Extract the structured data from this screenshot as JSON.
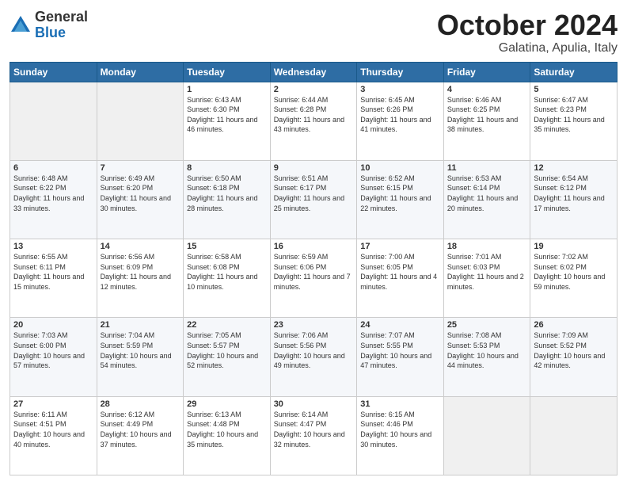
{
  "logo": {
    "general": "General",
    "blue": "Blue"
  },
  "title": {
    "month": "October 2024",
    "location": "Galatina, Apulia, Italy"
  },
  "headers": [
    "Sunday",
    "Monday",
    "Tuesday",
    "Wednesday",
    "Thursday",
    "Friday",
    "Saturday"
  ],
  "weeks": [
    [
      {
        "day": "",
        "info": ""
      },
      {
        "day": "",
        "info": ""
      },
      {
        "day": "1",
        "info": "Sunrise: 6:43 AM\nSunset: 6:30 PM\nDaylight: 11 hours and 46 minutes."
      },
      {
        "day": "2",
        "info": "Sunrise: 6:44 AM\nSunset: 6:28 PM\nDaylight: 11 hours and 43 minutes."
      },
      {
        "day": "3",
        "info": "Sunrise: 6:45 AM\nSunset: 6:26 PM\nDaylight: 11 hours and 41 minutes."
      },
      {
        "day": "4",
        "info": "Sunrise: 6:46 AM\nSunset: 6:25 PM\nDaylight: 11 hours and 38 minutes."
      },
      {
        "day": "5",
        "info": "Sunrise: 6:47 AM\nSunset: 6:23 PM\nDaylight: 11 hours and 35 minutes."
      }
    ],
    [
      {
        "day": "6",
        "info": "Sunrise: 6:48 AM\nSunset: 6:22 PM\nDaylight: 11 hours and 33 minutes."
      },
      {
        "day": "7",
        "info": "Sunrise: 6:49 AM\nSunset: 6:20 PM\nDaylight: 11 hours and 30 minutes."
      },
      {
        "day": "8",
        "info": "Sunrise: 6:50 AM\nSunset: 6:18 PM\nDaylight: 11 hours and 28 minutes."
      },
      {
        "day": "9",
        "info": "Sunrise: 6:51 AM\nSunset: 6:17 PM\nDaylight: 11 hours and 25 minutes."
      },
      {
        "day": "10",
        "info": "Sunrise: 6:52 AM\nSunset: 6:15 PM\nDaylight: 11 hours and 22 minutes."
      },
      {
        "day": "11",
        "info": "Sunrise: 6:53 AM\nSunset: 6:14 PM\nDaylight: 11 hours and 20 minutes."
      },
      {
        "day": "12",
        "info": "Sunrise: 6:54 AM\nSunset: 6:12 PM\nDaylight: 11 hours and 17 minutes."
      }
    ],
    [
      {
        "day": "13",
        "info": "Sunrise: 6:55 AM\nSunset: 6:11 PM\nDaylight: 11 hours and 15 minutes."
      },
      {
        "day": "14",
        "info": "Sunrise: 6:56 AM\nSunset: 6:09 PM\nDaylight: 11 hours and 12 minutes."
      },
      {
        "day": "15",
        "info": "Sunrise: 6:58 AM\nSunset: 6:08 PM\nDaylight: 11 hours and 10 minutes."
      },
      {
        "day": "16",
        "info": "Sunrise: 6:59 AM\nSunset: 6:06 PM\nDaylight: 11 hours and 7 minutes."
      },
      {
        "day": "17",
        "info": "Sunrise: 7:00 AM\nSunset: 6:05 PM\nDaylight: 11 hours and 4 minutes."
      },
      {
        "day": "18",
        "info": "Sunrise: 7:01 AM\nSunset: 6:03 PM\nDaylight: 11 hours and 2 minutes."
      },
      {
        "day": "19",
        "info": "Sunrise: 7:02 AM\nSunset: 6:02 PM\nDaylight: 10 hours and 59 minutes."
      }
    ],
    [
      {
        "day": "20",
        "info": "Sunrise: 7:03 AM\nSunset: 6:00 PM\nDaylight: 10 hours and 57 minutes."
      },
      {
        "day": "21",
        "info": "Sunrise: 7:04 AM\nSunset: 5:59 PM\nDaylight: 10 hours and 54 minutes."
      },
      {
        "day": "22",
        "info": "Sunrise: 7:05 AM\nSunset: 5:57 PM\nDaylight: 10 hours and 52 minutes."
      },
      {
        "day": "23",
        "info": "Sunrise: 7:06 AM\nSunset: 5:56 PM\nDaylight: 10 hours and 49 minutes."
      },
      {
        "day": "24",
        "info": "Sunrise: 7:07 AM\nSunset: 5:55 PM\nDaylight: 10 hours and 47 minutes."
      },
      {
        "day": "25",
        "info": "Sunrise: 7:08 AM\nSunset: 5:53 PM\nDaylight: 10 hours and 44 minutes."
      },
      {
        "day": "26",
        "info": "Sunrise: 7:09 AM\nSunset: 5:52 PM\nDaylight: 10 hours and 42 minutes."
      }
    ],
    [
      {
        "day": "27",
        "info": "Sunrise: 6:11 AM\nSunset: 4:51 PM\nDaylight: 10 hours and 40 minutes."
      },
      {
        "day": "28",
        "info": "Sunrise: 6:12 AM\nSunset: 4:49 PM\nDaylight: 10 hours and 37 minutes."
      },
      {
        "day": "29",
        "info": "Sunrise: 6:13 AM\nSunset: 4:48 PM\nDaylight: 10 hours and 35 minutes."
      },
      {
        "day": "30",
        "info": "Sunrise: 6:14 AM\nSunset: 4:47 PM\nDaylight: 10 hours and 32 minutes."
      },
      {
        "day": "31",
        "info": "Sunrise: 6:15 AM\nSunset: 4:46 PM\nDaylight: 10 hours and 30 minutes."
      },
      {
        "day": "",
        "info": ""
      },
      {
        "day": "",
        "info": ""
      }
    ]
  ]
}
